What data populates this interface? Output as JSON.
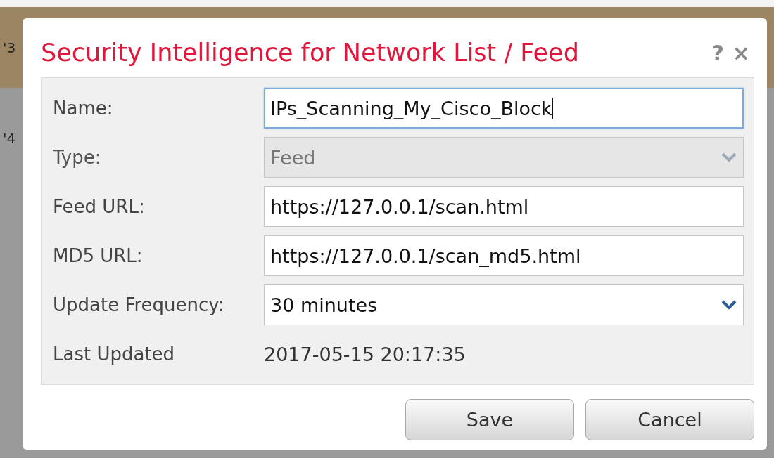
{
  "background": {
    "fragments": [
      "'3",
      "'4"
    ]
  },
  "dialog": {
    "title": "Security Intelligence for Network List / Feed",
    "help": "?",
    "close": "×",
    "fields": [
      {
        "kind": "text",
        "label": "Name:",
        "value": "IPs_Scanning_My_Cisco_Block",
        "focused": true,
        "disabled": false
      },
      {
        "kind": "select",
        "label": "Type:",
        "value": "Feed",
        "focused": false,
        "disabled": true
      },
      {
        "kind": "text",
        "label": "Feed URL:",
        "value": "https://127.0.0.1/scan.html",
        "focused": false,
        "disabled": false
      },
      {
        "kind": "text",
        "label": "MD5 URL:",
        "value": "https://127.0.0.1/scan_md5.html",
        "focused": false,
        "disabled": false
      },
      {
        "kind": "select",
        "label": "Update Frequency:",
        "value": "30 minutes",
        "focused": false,
        "disabled": false
      },
      {
        "kind": "static",
        "label": "Last Updated",
        "value": "2017-05-15 20:17:35"
      }
    ],
    "buttons": [
      "Save",
      "Cancel"
    ]
  }
}
